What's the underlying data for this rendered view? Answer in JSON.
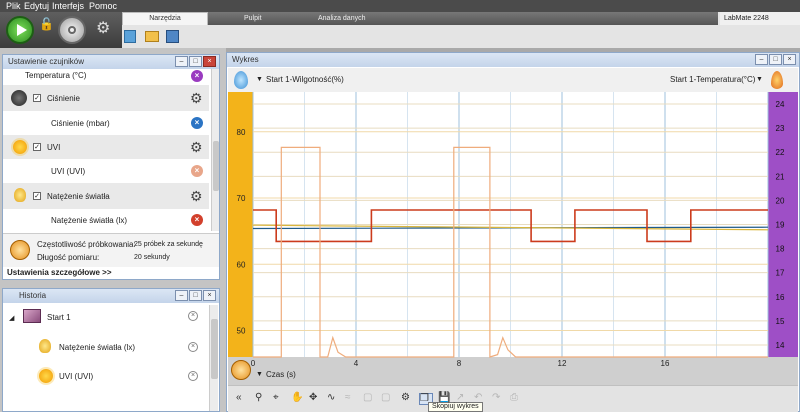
{
  "menu": [
    "Plik",
    "Edytuj",
    "Interfejs",
    "Pomoc"
  ],
  "tabs": {
    "narzedzia": "Narzędzia",
    "pulpit": "Pulpit",
    "analiza": "Analiza danych"
  },
  "device": "LabMate 2248",
  "sensors_panel": {
    "title": "Ustawienie czujników",
    "rows": [
      {
        "label": "Temperatura (°C)"
      },
      {
        "label": "Ciśnienie",
        "checked": true
      },
      {
        "label": "Ciśnienie (mbar)"
      },
      {
        "label": "UVI",
        "checked": true
      },
      {
        "label": "UVI (UVI)"
      },
      {
        "label": "Natężenie światła",
        "checked": true
      },
      {
        "label": "Natężenie światła (lx)"
      }
    ],
    "freq_label": "Częstotliwość próbkowania:",
    "freq_value": "25 próbek za sekundę",
    "dur_label": "Długość pomiaru:",
    "dur_value": "20 sekundy",
    "details_link": "Ustawienia szczegółowe >>"
  },
  "history_panel": {
    "title": "Historia",
    "run": "Start 1",
    "items": [
      "Natężenie światła (lx)",
      "UVI (UVI)"
    ]
  },
  "chart_panel": {
    "title": "Wykres",
    "left_series": "Start 1-Wilgotność(%)",
    "right_series": "Start 1-Temperatura(°C)",
    "x_label": "Czas (s)",
    "tooltip": "Skopiuj wykres"
  },
  "chart_data": {
    "type": "line",
    "xlabel": "Czas (s)",
    "x_ticks": [
      0,
      4,
      8,
      12,
      16
    ],
    "xlim": [
      0,
      20
    ],
    "y_left_ticks": [
      50,
      60,
      70,
      80
    ],
    "ylim_left": [
      46,
      86
    ],
    "y_right_ticks": [
      14,
      15,
      16,
      17,
      18,
      19,
      20,
      21,
      22,
      23,
      24
    ],
    "ylim_right": [
      13.5,
      24.5
    ],
    "grid": true,
    "colors": {
      "humidity": "#1f5a8a",
      "temperature": "#cc3b1c",
      "light": "#efac7c",
      "uvi": "#d9b63c",
      "axis_left": "#f3b31a",
      "axis_right": "#9e4fc6"
    },
    "series": [
      {
        "axis": "left",
        "color": "humidity",
        "x": [
          0,
          20
        ],
        "y": [
          65.4,
          65.6
        ]
      },
      {
        "axis": "left",
        "color": "uvi",
        "x": [
          0,
          20
        ],
        "y": [
          65.9,
          65.2
        ]
      },
      {
        "axis": "right",
        "color": "temperature",
        "x": [
          0,
          0.9,
          0.9,
          4.6,
          4.6,
          10.8,
          10.8,
          12.5,
          12.5,
          15.3,
          15.3,
          17.0,
          17.0,
          20
        ],
        "y": [
          19.6,
          19.6,
          18.3,
          18.3,
          19.6,
          19.6,
          18.3,
          18.3,
          19.6,
          19.6,
          18.3,
          18.3,
          19.6,
          19.6
        ]
      },
      {
        "axis": "right",
        "color": "light",
        "x": [
          0,
          1.1,
          1.1,
          2.6,
          2.6,
          2.9,
          3.1,
          3.3,
          3.6,
          7.8,
          7.8,
          9.2,
          9.2,
          9.5,
          9.7,
          9.9,
          10.2,
          20
        ],
        "y": [
          13.5,
          13.5,
          22.2,
          22.2,
          13.5,
          13.5,
          14.3,
          13.7,
          13.5,
          13.5,
          22.2,
          22.2,
          13.5,
          13.6,
          14.3,
          13.8,
          13.5,
          13.5
        ]
      }
    ]
  }
}
